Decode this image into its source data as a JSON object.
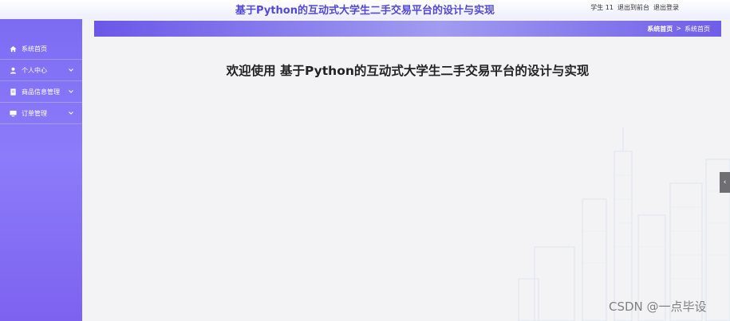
{
  "header": {
    "title": "基于Python的互动式大学生二手交易平台的设计与实现",
    "user_label": "学生 11",
    "back_link": "退出到前台",
    "logout_link": "退出登录"
  },
  "sidebar": {
    "items": [
      {
        "label": "系统首页",
        "icon": "home-icon",
        "has_submenu": false
      },
      {
        "label": "个人中心",
        "icon": "user-icon",
        "has_submenu": true
      },
      {
        "label": "商品信息管理",
        "icon": "document-icon",
        "has_submenu": true
      },
      {
        "label": "订单管理",
        "icon": "monitor-icon",
        "has_submenu": true
      }
    ]
  },
  "breadcrumb": {
    "item1": "系统首页",
    "separator": ">",
    "item2": "系统首页"
  },
  "main": {
    "welcome": "欢迎使用 基于Python的互动式大学生二手交易平台的设计与实现"
  },
  "side_tab": {
    "icon": "chevron-left-icon"
  },
  "watermark": "CSDN @一点毕设",
  "colors": {
    "accent": "#5148dc",
    "sidebar": "#8c7cfa",
    "breadcrumb_bar": "#6a57e8"
  }
}
